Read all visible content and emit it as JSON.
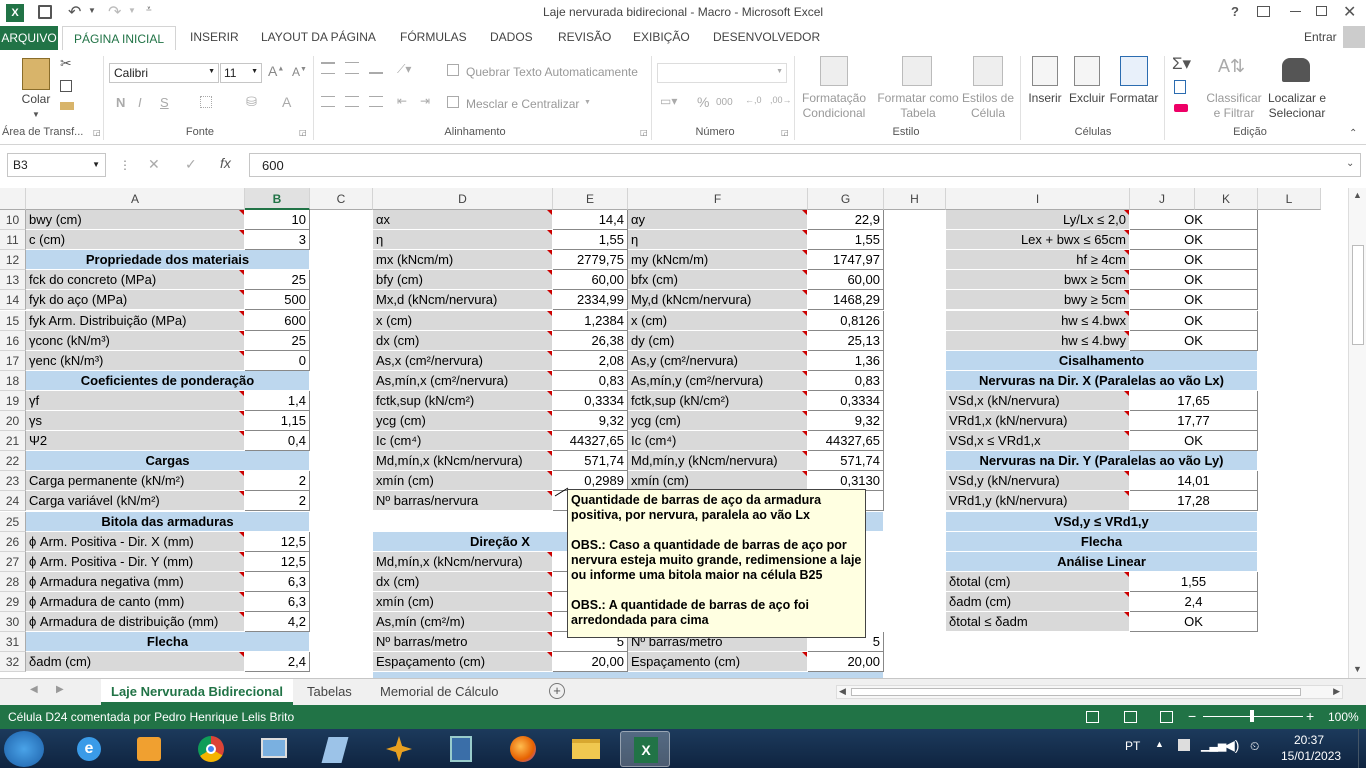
{
  "window": {
    "title": "Laje nervurada bidirecional - Macro - Microsoft Excel",
    "help": "?",
    "user": "Entrar"
  },
  "tabs": [
    "ARQUIVO",
    "PÁGINA INICIAL",
    "INSERIR",
    "LAYOUT DA PÁGINA",
    "FÓRMULAS",
    "DADOS",
    "REVISÃO",
    "EXIBIÇÃO",
    "DESENVOLVEDOR"
  ],
  "ribbon": {
    "paste": "Colar",
    "clipboard": "Área de Transf...",
    "font_name": "Calibri",
    "font_size": "11",
    "bold": "N",
    "italic": "I",
    "underline": "S",
    "font_group": "Fonte",
    "wrap": "Quebrar Texto Automaticamente",
    "merge": "Mesclar e Centralizar",
    "align_group": "Alinhamento",
    "number_group": "Número",
    "percent": "%",
    "thousands": "000",
    "cond_format_1": "Formatação",
    "cond_format_2": "Condicional",
    "format_table_1": "Formatar como",
    "format_table_2": "Tabela",
    "cell_styles_1": "Estilos de",
    "cell_styles_2": "Célula",
    "styles_group": "Estilo",
    "insert": "Inserir",
    "delete": "Excluir",
    "format": "Formatar",
    "cells_group": "Células",
    "sort_1": "Classificar",
    "sort_2": "e Filtrar",
    "find_1": "Localizar e",
    "find_2": "Selecionar",
    "edit_group": "Edição"
  },
  "formula_bar": {
    "name_box": "B3",
    "fx": "fx",
    "value": "600"
  },
  "columns": [
    "A",
    "B",
    "C",
    "D",
    "E",
    "F",
    "G",
    "H",
    "I",
    "J",
    "K",
    "L"
  ],
  "rows": [
    {
      "n": "10",
      "A": "bwy (cm)",
      "B": "10",
      "D": "αx",
      "E": "14,4",
      "F": "αy",
      "G": "22,9",
      "I": "Ly/Lx ≤ 2,0",
      "J": "OK"
    },
    {
      "n": "11",
      "A": "c (cm)",
      "B": "3",
      "D": "η",
      "E": "1,55",
      "F": "η",
      "G": "1,55",
      "I": "Lex + bwx ≤ 65cm",
      "J": "OK"
    },
    {
      "n": "12",
      "A": "Propriedade dos materiais",
      "D": "mx (kNcm/m)",
      "E": "2779,75",
      "F": "my (kNcm/m)",
      "G": "1747,97",
      "I": "hf ≥ 4cm",
      "J": "OK"
    },
    {
      "n": "13",
      "A": "fck do concreto (MPa)",
      "B": "25",
      "D": "bfy (cm)",
      "E": "60,00",
      "F": "bfx (cm)",
      "G": "60,00",
      "I": "bwx ≥ 5cm",
      "J": "OK"
    },
    {
      "n": "14",
      "A": "fyk do aço (MPa)",
      "B": "500",
      "D": "Mx,d (kNcm/nervura)",
      "E": "2334,99",
      "F": "My,d (kNcm/nervura)",
      "G": "1468,29",
      "I": "bwy ≥ 5cm",
      "J": "OK"
    },
    {
      "n": "15",
      "A": "fyk Arm. Distribuição (MPa)",
      "B": "600",
      "D": "x (cm)",
      "E": "1,2384",
      "F": "x (cm)",
      "G": "0,8126",
      "I": "hw ≤ 4.bwx",
      "J": "OK"
    },
    {
      "n": "16",
      "A": "γconc (kN/m³)",
      "B": "25",
      "D": "dx (cm)",
      "E": "26,38",
      "F": "dy (cm)",
      "G": "25,13",
      "I": "hw ≤ 4.bwy",
      "J": "OK"
    },
    {
      "n": "17",
      "A": "γenc (kN/m³)",
      "B": "0",
      "D": "As,x (cm²/nervura)",
      "E": "2,08",
      "F": "As,y (cm²/nervura)",
      "G": "1,36",
      "I": "Cisalhamento",
      "J": ""
    },
    {
      "n": "18",
      "A": "Coeficientes de ponderação",
      "D": "As,mín,x (cm²/nervura)",
      "E": "0,83",
      "F": "As,mín,y (cm²/nervura)",
      "G": "0,83",
      "I": "Nervuras na Dir. X (Paralelas ao vão Lx)",
      "J": ""
    },
    {
      "n": "19",
      "A": "γf",
      "B": "1,4",
      "D": "fctk,sup (kN/cm²)",
      "E": "0,3334",
      "F": "fctk,sup (kN/cm²)",
      "G": "0,3334",
      "I": "VSd,x (kN/nervura)",
      "J": "17,65"
    },
    {
      "n": "20",
      "A": "γs",
      "B": "1,15",
      "D": "ycg (cm)",
      "E": "9,32",
      "F": "ycg (cm)",
      "G": "9,32",
      "I": "VRd1,x (kN/nervura)",
      "J": "17,77"
    },
    {
      "n": "21",
      "A": "Ψ2",
      "B": "0,4",
      "D": "Ic (cm⁴)",
      "E": "44327,65",
      "F": "Ic (cm⁴)",
      "G": "44327,65",
      "I": "VSd,x ≤ VRd1,x",
      "J": "OK"
    },
    {
      "n": "22",
      "A": "Cargas",
      "D": "Md,mín,x (kNcm/nervura)",
      "E": "571,74",
      "F": "Md,mín,y (kNcm/nervura)",
      "G": "571,74",
      "I": "Nervuras na Dir. Y (Paralelas ao vão Ly)",
      "J": ""
    },
    {
      "n": "23",
      "A": "Carga permanente (kN/m²)",
      "B": "2",
      "D": "xmín (cm)",
      "E": "0,2989",
      "F": "xmín (cm)",
      "G": "0,3130",
      "I": "VSd,y (kN/nervura)",
      "J": "14,01"
    },
    {
      "n": "24",
      "A": "Carga variável (kN/m²)",
      "B": "2",
      "D": "Nº barras/nervura",
      "E": "",
      "F": "",
      "G": "",
      "I": "VRd1,y (kN/nervura)",
      "J": "17,28"
    },
    {
      "n": "25",
      "A": "Bitola das armaduras",
      "D": "",
      "E": "",
      "F": "",
      "G": "",
      "I": "VSd,y ≤ VRd1,y",
      "J": "OK"
    },
    {
      "n": "26",
      "A": "ϕ Arm. Positiva - Dir. X (mm)",
      "B": "12,5",
      "D": "Direção X",
      "I": "Flecha",
      "J": ""
    },
    {
      "n": "27",
      "A": "ϕ Arm. Positiva - Dir. Y (mm)",
      "B": "12,5",
      "D": "Md,mín,x (kNcm/nervura)",
      "I": "Análise Linear",
      "J": ""
    },
    {
      "n": "28",
      "A": "ϕ Armadura negativa (mm)",
      "B": "6,3",
      "D": "dx (cm)",
      "I": "δtotal (cm)",
      "J": "1,55"
    },
    {
      "n": "29",
      "A": "ϕ Armadura de canto (mm)",
      "B": "6,3",
      "D": "xmín (cm)",
      "I": "δadm (cm)",
      "J": "2,4"
    },
    {
      "n": "30",
      "A": "ϕ Armadura de distribuição (mm)",
      "B": "4,2",
      "D": "As,mín (cm²/m)",
      "I": "δtotal ≤ δadm",
      "J": "OK"
    },
    {
      "n": "31",
      "A": "Flecha",
      "D": "Nº barras/metro",
      "E": "5",
      "F": "Nº barras/metro",
      "G": "5"
    },
    {
      "n": "32",
      "A": "δadm (cm)",
      "B": "2,4",
      "D": "Espaçamento (cm)",
      "E": "20,00",
      "F": "Espaçamento (cm)",
      "G": "20,00"
    }
  ],
  "tooltip": {
    "line1": "Quantidade de barras de aço da armadura positiva, por nervura, paralela ao vão Lx",
    "line2": "OBS.: Caso a quantidade de barras de aço por nervura esteja muito grande, redimensione a laje ou informe uma bitola maior na célula B25",
    "line3": "OBS.: A quantidade de barras de aço foi arredondada para cima"
  },
  "sheet_tabs": [
    "Laje Nervurada Bidirecional",
    "Tabelas",
    "Memorial de Cálculo"
  ],
  "status": {
    "text": "Célula D24 comentada por Pedro Henrique Lelis Brito",
    "zoom": "100%"
  },
  "taskbar": {
    "lang": "PT",
    "time": "20:37",
    "date": "15/01/2023"
  },
  "colors": {
    "excel_green": "#217346",
    "header_blue": "#bdd7ee",
    "label_gray": "#d9d9d9"
  }
}
